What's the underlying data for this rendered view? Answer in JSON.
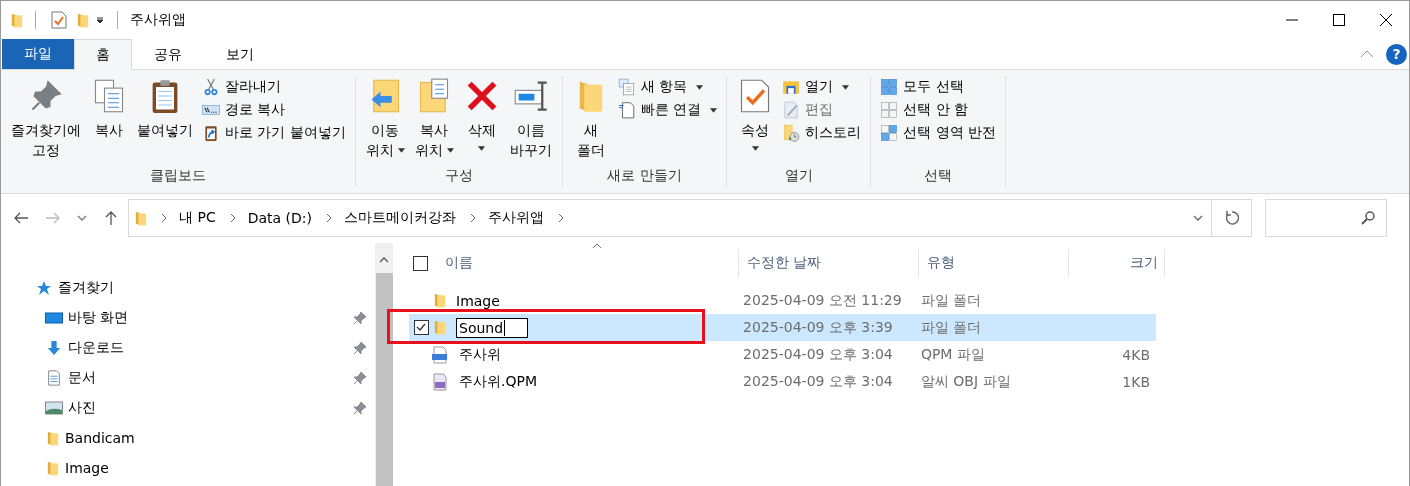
{
  "window": {
    "title": "주사위앱",
    "help": "?"
  },
  "tabs": [
    {
      "label": "파일",
      "kind": "file",
      "selected": false
    },
    {
      "label": "홈",
      "kind": "tab",
      "selected": true
    },
    {
      "label": "공유",
      "kind": "tab",
      "selected": false
    },
    {
      "label": "보기",
      "kind": "tab",
      "selected": false
    }
  ],
  "ribbon": [
    {
      "label": "클립보드",
      "large": [
        {
          "lines": [
            "즐겨찾기에",
            "고정"
          ],
          "dropdown": false
        },
        {
          "lines": [
            "복사"
          ],
          "dropdown": false
        },
        {
          "lines": [
            "붙여넣기"
          ],
          "dropdown": false
        }
      ],
      "small": [
        {
          "label": "잘라내기",
          "dropdown": false,
          "disabled": false
        },
        {
          "label": "경로 복사",
          "dropdown": false,
          "disabled": false
        },
        {
          "label": "바로 가기 붙여넣기",
          "dropdown": false,
          "disabled": false
        }
      ]
    },
    {
      "label": "구성",
      "large": [
        {
          "lines": [
            "이동",
            "위치"
          ],
          "dropdown": true
        },
        {
          "lines": [
            "복사",
            "위치"
          ],
          "dropdown": true
        },
        {
          "lines": [
            "삭제"
          ],
          "dropdown": true
        },
        {
          "lines": [
            "이름",
            "바꾸기"
          ],
          "dropdown": false
        }
      ]
    },
    {
      "label": "새로 만들기",
      "large": [
        {
          "lines": [
            "새",
            "폴더"
          ],
          "dropdown": false
        }
      ],
      "small": [
        {
          "label": "새 항목",
          "dropdown": true,
          "disabled": false
        },
        {
          "label": "빠른 연결",
          "dropdown": true,
          "disabled": false
        }
      ]
    },
    {
      "label": "열기",
      "large": [
        {
          "lines": [
            "속성"
          ],
          "dropdown": true
        }
      ],
      "small": [
        {
          "label": "열기",
          "dropdown": true,
          "disabled": false
        },
        {
          "label": "편집",
          "dropdown": false,
          "disabled": true
        },
        {
          "label": "히스토리",
          "dropdown": false,
          "disabled": false
        }
      ]
    },
    {
      "label": "선택",
      "small": [
        {
          "label": "모두 선택",
          "dropdown": false,
          "disabled": false
        },
        {
          "label": "선택 안 함",
          "dropdown": false,
          "disabled": false
        },
        {
          "label": "선택 영역 반전",
          "dropdown": false,
          "disabled": false
        }
      ]
    }
  ],
  "address": {
    "path": [
      "내 PC",
      "Data (D:)",
      "스마트메이커강좌",
      "주사위앱"
    ]
  },
  "navigation": [
    {
      "label": "즐겨찾기",
      "children": [
        {
          "label": "바탕 화면",
          "pinned": true
        },
        {
          "label": "다운로드",
          "pinned": true
        },
        {
          "label": "문서",
          "pinned": true
        },
        {
          "label": "사진",
          "pinned": true
        },
        {
          "label": "Bandicam",
          "pinned": false
        },
        {
          "label": "Image",
          "pinned": false
        }
      ]
    }
  ],
  "file_list": {
    "select_all_checked": false,
    "columns": [
      {
        "label": "이름",
        "sorted": true
      },
      {
        "label": "수정한 날짜",
        "sorted": false
      },
      {
        "label": "유형",
        "sorted": false
      },
      {
        "label": "크기",
        "sorted": false
      }
    ],
    "rows": [
      {
        "kind": "folder",
        "name": "Image",
        "date": "2025-04-09 오전 11:29",
        "type": "파일 폴더",
        "selected": false,
        "checked": false,
        "renaming": false
      },
      {
        "kind": "folder",
        "name": "Sound",
        "date": "2025-04-09 오후 3:39",
        "type": "파일 폴더",
        "selected": true,
        "checked": true,
        "renaming": true
      },
      {
        "kind": "qpm",
        "name": "주사위",
        "date": "2025-04-09 오후 3:04",
        "type": "QPM 파일",
        "size": "4KB",
        "selected": false,
        "checked": false,
        "renaming": false
      },
      {
        "kind": "obj",
        "name": "주사위.QPM",
        "date": "2025-04-09 오후 3:04",
        "type": "알씨 OBJ 파일",
        "size": "1KB",
        "selected": false,
        "checked": false,
        "renaming": false
      }
    ]
  }
}
